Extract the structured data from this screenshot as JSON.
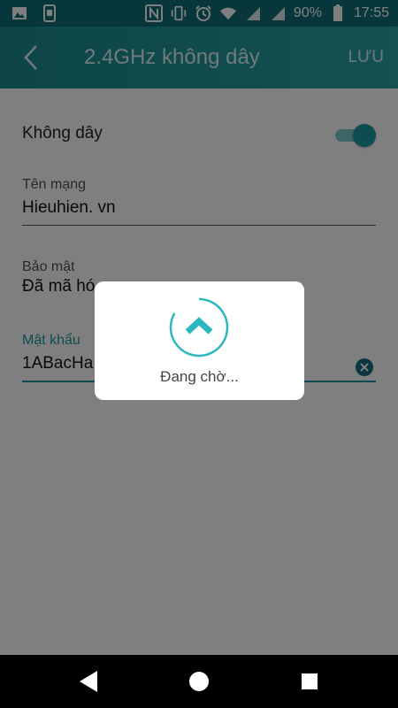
{
  "status_bar": {
    "battery_text": "90%",
    "time": "17:55",
    "icons": [
      "image-icon",
      "screenshot-icon",
      "nfc-icon",
      "vibrate-icon",
      "alarm-icon",
      "wifi-icon",
      "signal-icon",
      "signal-icon",
      "battery-icon"
    ]
  },
  "app_bar": {
    "title": "2.4GHz không dây",
    "save_label": "LƯU"
  },
  "settings": {
    "wireless_label": "Không dây",
    "wireless_enabled": true,
    "network_name": {
      "label": "Tên mạng",
      "value": "Hieuhien. vn"
    },
    "security": {
      "label": "Bảo mật",
      "value": "Đã mã hó"
    },
    "password": {
      "label": "Mật khẩu",
      "value": "1ABacHa"
    }
  },
  "dialog": {
    "message": "Đang chờ..."
  },
  "colors": {
    "accent": "#1a9aa1",
    "app_bar": "#1a8a90",
    "status_bar": "#0f6f76"
  }
}
